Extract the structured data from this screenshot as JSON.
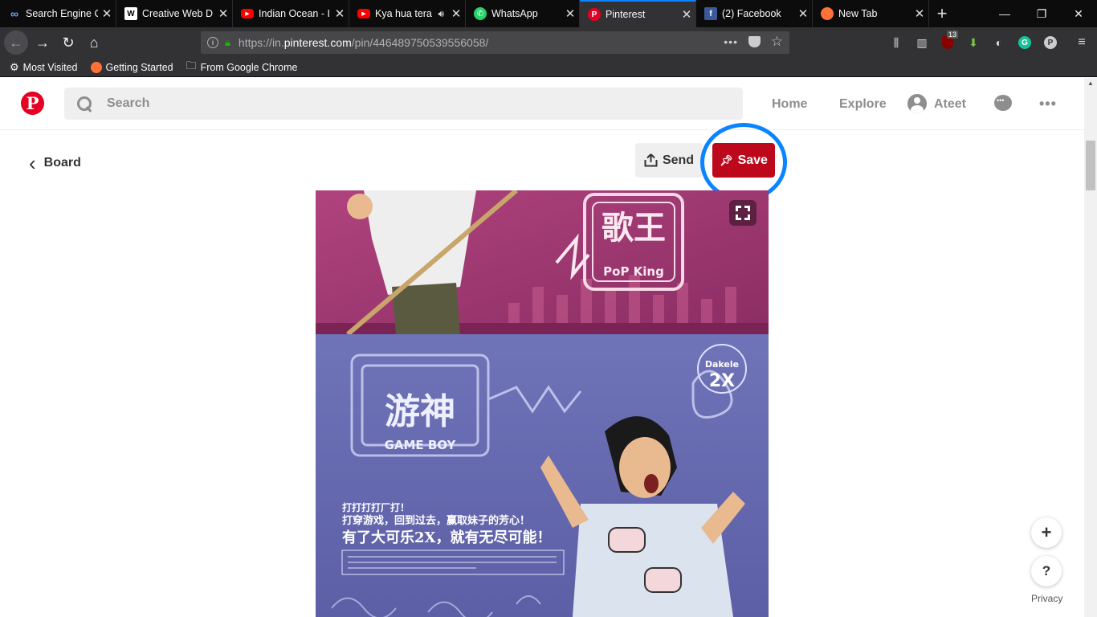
{
  "browser": {
    "tabs": [
      {
        "title": "Search Engine O",
        "icon": "infinity-icon",
        "active": false
      },
      {
        "title": "Creative Web D",
        "icon": "w-icon",
        "active": false
      },
      {
        "title": "Indian Ocean - I",
        "icon": "youtube-icon",
        "active": false
      },
      {
        "title": "Kya hua tera",
        "icon": "youtube-icon",
        "active": false,
        "audio": true
      },
      {
        "title": "WhatsApp",
        "icon": "whatsapp-icon",
        "active": false
      },
      {
        "title": "Pinterest",
        "icon": "pinterest-icon",
        "active": true
      },
      {
        "title": "(2) Facebook",
        "icon": "facebook-icon",
        "active": false
      },
      {
        "title": "New Tab",
        "icon": "firefox-icon",
        "active": false
      }
    ],
    "url_prefix": "https://in.",
    "url_domain": "pinterest.com",
    "url_path": "/pin/446489750539556058/",
    "toolbar_badge": "13",
    "bookmarks": [
      {
        "label": "Most Visited",
        "icon": "gear-icon"
      },
      {
        "label": "Getting Started",
        "icon": "firefox-icon"
      },
      {
        "label": "From Google Chrome",
        "icon": "folder-icon"
      }
    ]
  },
  "pinterest": {
    "search_placeholder": "Search",
    "nav": {
      "home": "Home",
      "explore": "Explore",
      "user": "Ateet"
    },
    "board_label": "Board",
    "send_label": "Send",
    "save_label": "Save",
    "privacy_label": "Privacy",
    "help_label": "?",
    "add_label": "+"
  },
  "image_text": {
    "top_title": "歌王",
    "top_sub": "PoP King",
    "mid_title": "游神",
    "mid_sub": "GAME BOY",
    "brand": "Dakele",
    "brand_2x": "2X",
    "line1": "打打打打厂打！",
    "line2": "打穿游戏，回到过去，赢取妹子的芳心！",
    "line3": "有了大可乐2X，就有无尽可能！"
  },
  "colors": {
    "accent": "#bd081c",
    "focus_ring": "#0a84ff"
  }
}
